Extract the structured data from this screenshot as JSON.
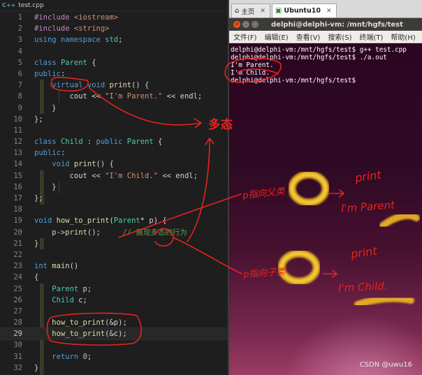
{
  "editor": {
    "tab_name": "test.cpp",
    "lines": [
      {
        "n": "1",
        "parts": [
          [
            "pre",
            "#include "
          ],
          [
            "inc",
            "<iostream>"
          ]
        ]
      },
      {
        "n": "2",
        "parts": [
          [
            "pre",
            "#include "
          ],
          [
            "inc",
            "<string>"
          ]
        ]
      },
      {
        "n": "3",
        "parts": [
          [
            "kw",
            "using "
          ],
          [
            "kw",
            "namespace "
          ],
          [
            "ty",
            "std"
          ],
          [
            "id",
            ";"
          ]
        ]
      },
      {
        "n": "4",
        "parts": []
      },
      {
        "n": "5",
        "parts": [
          [
            "kw",
            "class "
          ],
          [
            "ty",
            "Parent"
          ],
          [
            "id",
            " {"
          ]
        ]
      },
      {
        "n": "6",
        "parts": [
          [
            "kw",
            "public"
          ],
          [
            "id",
            ":"
          ]
        ]
      },
      {
        "n": "7",
        "parts": [
          [
            "id",
            "    "
          ],
          [
            "kw",
            "virtual "
          ],
          [
            "kw",
            "void "
          ],
          [
            "fn",
            "print"
          ],
          [
            "id",
            "() {"
          ]
        ]
      },
      {
        "n": "8",
        "parts": [
          [
            "id",
            "        cout << "
          ],
          [
            "str",
            "\"I'm Parent.\""
          ],
          [
            "id",
            " << endl;"
          ]
        ]
      },
      {
        "n": "9",
        "parts": [
          [
            "id",
            "    }"
          ]
        ]
      },
      {
        "n": "10",
        "parts": [
          [
            "id",
            "};"
          ]
        ]
      },
      {
        "n": "11",
        "parts": []
      },
      {
        "n": "12",
        "parts": [
          [
            "kw",
            "class "
          ],
          [
            "ty",
            "Child"
          ],
          [
            "id",
            " : "
          ],
          [
            "kw",
            "public "
          ],
          [
            "ty",
            "Parent"
          ],
          [
            "id",
            " {"
          ]
        ]
      },
      {
        "n": "13",
        "parts": [
          [
            "kw",
            "public"
          ],
          [
            "id",
            ":"
          ]
        ]
      },
      {
        "n": "14",
        "parts": [
          [
            "id",
            "    "
          ],
          [
            "kw",
            "void "
          ],
          [
            "fn",
            "print"
          ],
          [
            "id",
            "() {"
          ]
        ]
      },
      {
        "n": "15",
        "parts": [
          [
            "id",
            "        cout << "
          ],
          [
            "str",
            "\"I'm Child.\""
          ],
          [
            "id",
            " << endl;"
          ]
        ]
      },
      {
        "n": "16",
        "parts": [
          [
            "id",
            "    }"
          ]
        ]
      },
      {
        "n": "17",
        "parts": [
          [
            "id",
            "};"
          ]
        ]
      },
      {
        "n": "18",
        "parts": []
      },
      {
        "n": "19",
        "parts": [
          [
            "kw",
            "void "
          ],
          [
            "fn",
            "how_to_print"
          ],
          [
            "id",
            "("
          ],
          [
            "ty",
            "Parent"
          ],
          [
            "id",
            "* p) {"
          ]
        ]
      },
      {
        "n": "20",
        "parts": [
          [
            "id",
            "    p->"
          ],
          [
            "fn",
            "print"
          ],
          [
            "id",
            "();     "
          ],
          [
            "cmt",
            "// 展现多态的行为"
          ]
        ]
      },
      {
        "n": "21",
        "parts": [
          [
            "id",
            "}"
          ]
        ]
      },
      {
        "n": "22",
        "parts": []
      },
      {
        "n": "23",
        "parts": [
          [
            "kw",
            "int "
          ],
          [
            "fn",
            "main"
          ],
          [
            "id",
            "()"
          ]
        ]
      },
      {
        "n": "24",
        "parts": [
          [
            "id",
            "{"
          ]
        ]
      },
      {
        "n": "25",
        "parts": [
          [
            "id",
            "    "
          ],
          [
            "ty",
            "Parent"
          ],
          [
            "id",
            " p;"
          ]
        ]
      },
      {
        "n": "26",
        "parts": [
          [
            "id",
            "    "
          ],
          [
            "ty",
            "Child"
          ],
          [
            "id",
            " c;"
          ]
        ]
      },
      {
        "n": "27",
        "parts": []
      },
      {
        "n": "28",
        "parts": [
          [
            "id",
            "    "
          ],
          [
            "fn",
            "how_to_print"
          ],
          [
            "id",
            "(&p);"
          ]
        ]
      },
      {
        "n": "29",
        "parts": [
          [
            "id",
            "    "
          ],
          [
            "fn",
            "how_to_print"
          ],
          [
            "id",
            "(&c);"
          ]
        ]
      },
      {
        "n": "30",
        "parts": []
      },
      {
        "n": "31",
        "parts": [
          [
            "id",
            "    "
          ],
          [
            "kw",
            "return "
          ],
          [
            "num",
            "0"
          ],
          [
            "id",
            ";"
          ]
        ]
      },
      {
        "n": "32",
        "parts": [
          [
            "id",
            "}"
          ]
        ]
      }
    ],
    "current_line": "29"
  },
  "vm": {
    "tabs": [
      {
        "label": "主页",
        "icon": "home-icon"
      },
      {
        "label": "Ubuntu10",
        "icon": "vm-icon"
      }
    ]
  },
  "terminal": {
    "title": "delphi@delphi-vm: /mnt/hgfs/test",
    "menu": [
      "文件(F)",
      "编辑(E)",
      "查看(V)",
      "搜索(S)",
      "终端(T)",
      "帮助(H)"
    ],
    "lines": [
      "delphi@delphi-vm:/mnt/hgfs/test$ g++ test.cpp",
      "delphi@delphi-vm:/mnt/hgfs/test$ ./a.out",
      "I'm Parent.",
      "I'm Child.",
      "delphi@delphi-vm:/mnt/hgfs/test$ "
    ]
  },
  "annotations": {
    "polymorphism": "多态",
    "points_parent": "p指向父类",
    "points_child": "p指向子类",
    "print_1": "print",
    "print_2": "print",
    "out_parent": "I'm Parent",
    "out_child": "I'm Child."
  },
  "watermark": "CSDN @uwu16",
  "colors": {
    "terminal_bg": "#300a24",
    "annotation_red": "#e8231c",
    "highlight_yellow": "#f5c518"
  }
}
